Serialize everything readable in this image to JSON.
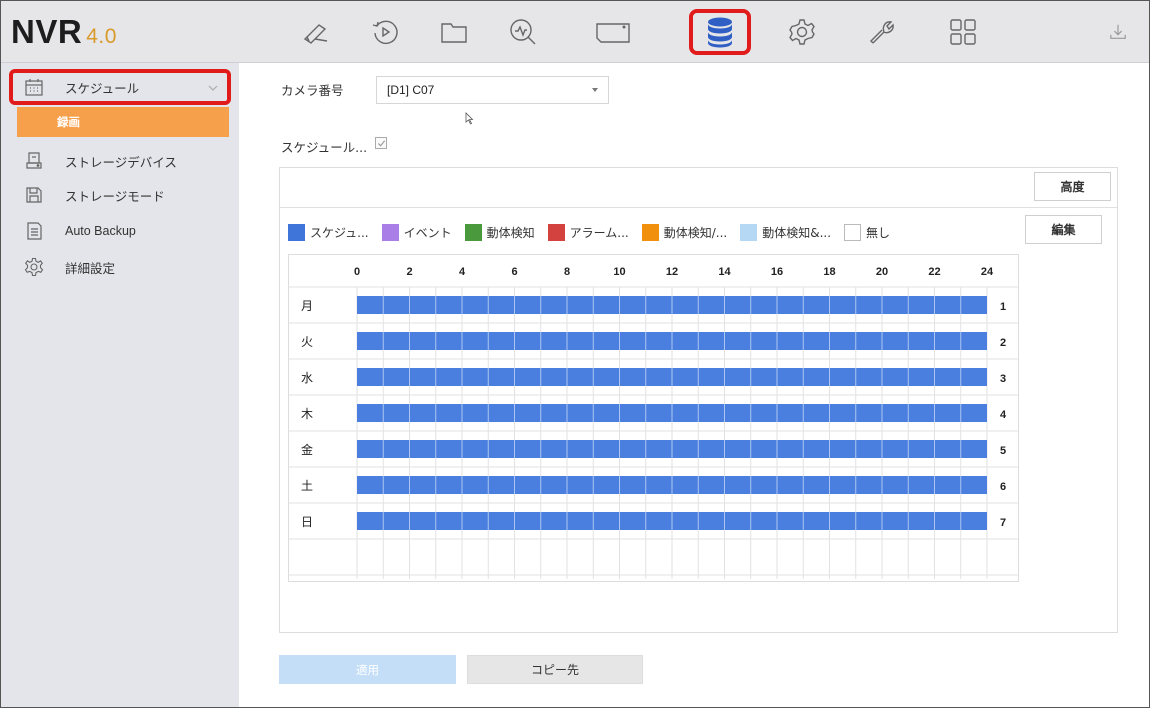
{
  "app": {
    "logo": "NVR",
    "version": "4.0"
  },
  "topnav": {
    "items": [
      {
        "icon": "live-view-icon"
      },
      {
        "icon": "playback-icon"
      },
      {
        "icon": "file-folder-icon"
      },
      {
        "icon": "smart-search-icon"
      },
      {
        "icon": "display-icon"
      },
      {
        "icon": "storage-database-icon",
        "active": true
      },
      {
        "icon": "settings-gear-icon"
      },
      {
        "icon": "maintenance-wrench-icon"
      },
      {
        "icon": "grid-apps-icon"
      },
      {
        "icon": "download-icon"
      }
    ],
    "highlight_color": "#e11a1a",
    "active_icon_color": "#2f5fc4"
  },
  "sidebar": {
    "items": [
      {
        "label": "スケジュール",
        "icon": "calendar-icon"
      },
      {
        "label": "録画",
        "icon": ""
      },
      {
        "label": "ストレージデバイス",
        "icon": "hdd-device-icon"
      },
      {
        "label": "ストレージモード",
        "icon": "save-disk-icon"
      },
      {
        "label": "Auto Backup",
        "icon": "backup-document-icon"
      },
      {
        "label": "詳細設定",
        "icon": "advanced-gear-icon"
      }
    ],
    "active_sub_color": "#f7a04b"
  },
  "form": {
    "camera_label": "カメラ番号",
    "camera_value": "[D1] C07",
    "schedule_enable_label": "スケジュール...",
    "schedule_enabled": true
  },
  "panel": {
    "advanced_label": "高度",
    "edit_label": "編集"
  },
  "legend": [
    {
      "label": "スケジュ...",
      "color": "#3f74d9"
    },
    {
      "label": "イベント",
      "color": "#a97ee6"
    },
    {
      "label": "動体検知",
      "color": "#4a9a3d"
    },
    {
      "label": "アラーム...",
      "color": "#d44240"
    },
    {
      "label": "動体検知/...",
      "color": "#f0900d"
    },
    {
      "label": "動体検知&...",
      "color": "#b5d9f4"
    },
    {
      "label": "無し",
      "color": "#ffffff"
    }
  ],
  "schedule": {
    "hour_ticks": [
      "0",
      "2",
      "4",
      "6",
      "8",
      "10",
      "12",
      "14",
      "16",
      "18",
      "20",
      "22",
      "24"
    ],
    "days": [
      {
        "label": "月",
        "num": "1",
        "start": 0,
        "end": 24
      },
      {
        "label": "火",
        "num": "2",
        "start": 0,
        "end": 24
      },
      {
        "label": "水",
        "num": "3",
        "start": 0,
        "end": 24
      },
      {
        "label": "木",
        "num": "4",
        "start": 0,
        "end": 24
      },
      {
        "label": "金",
        "num": "5",
        "start": 0,
        "end": 24
      },
      {
        "label": "土",
        "num": "6",
        "start": 0,
        "end": 24
      },
      {
        "label": "日",
        "num": "7",
        "start": 0,
        "end": 24
      }
    ],
    "bar_color": "#4a7fe0"
  },
  "footer": {
    "apply_label": "適用",
    "copy_label": "コピー先"
  }
}
